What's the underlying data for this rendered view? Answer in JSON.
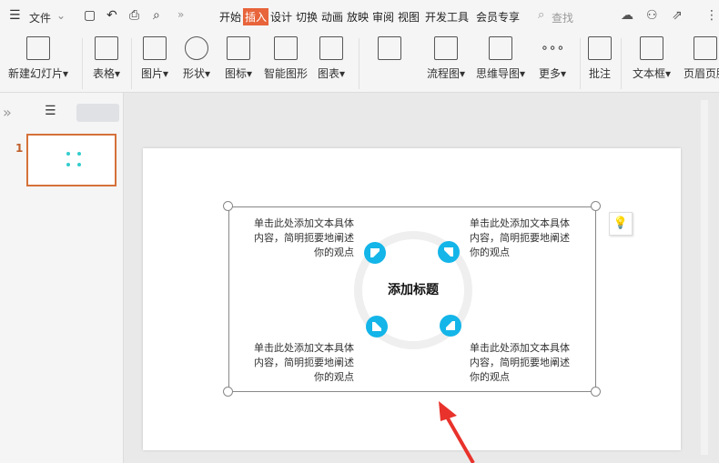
{
  "topbar": {
    "menu": "文件",
    "tabs": [
      "开始",
      "插入",
      "设计",
      "切换",
      "动画",
      "放映",
      "审阅",
      "视图",
      "开发工具",
      "会员专享"
    ],
    "active_tab": "插入",
    "search": "查找"
  },
  "ribbon": {
    "items": [
      "新建幻灯片",
      "表格",
      "图片",
      "形状",
      "图标",
      "智能图形",
      "图表",
      "",
      "流程图",
      "思维导图",
      "更多",
      "批注",
      "文本框",
      "页眉页脚"
    ]
  },
  "thumbnails": [
    {
      "number": "1"
    }
  ],
  "slide": {
    "title": "添加标题",
    "blocks": [
      {
        "line1": "单击此处添加文本具体",
        "line2": "内容，简明扼要地阐述",
        "line3": "你的观点"
      },
      {
        "line1": "单击此处添加文本具体",
        "line2": "内容，简明扼要地阐述",
        "line3": "你的观点"
      },
      {
        "line1": "单击此处添加文本具体",
        "line2": "内容，简明扼要地阐述",
        "line3": "你的观点"
      },
      {
        "line1": "单击此处添加文本具体",
        "line2": "内容，简明扼要地阐述",
        "line3": "你的观点"
      }
    ]
  },
  "colors": {
    "accent": "#e8643a",
    "diagram": "#14b5e8",
    "arrow": "#e8322b"
  }
}
